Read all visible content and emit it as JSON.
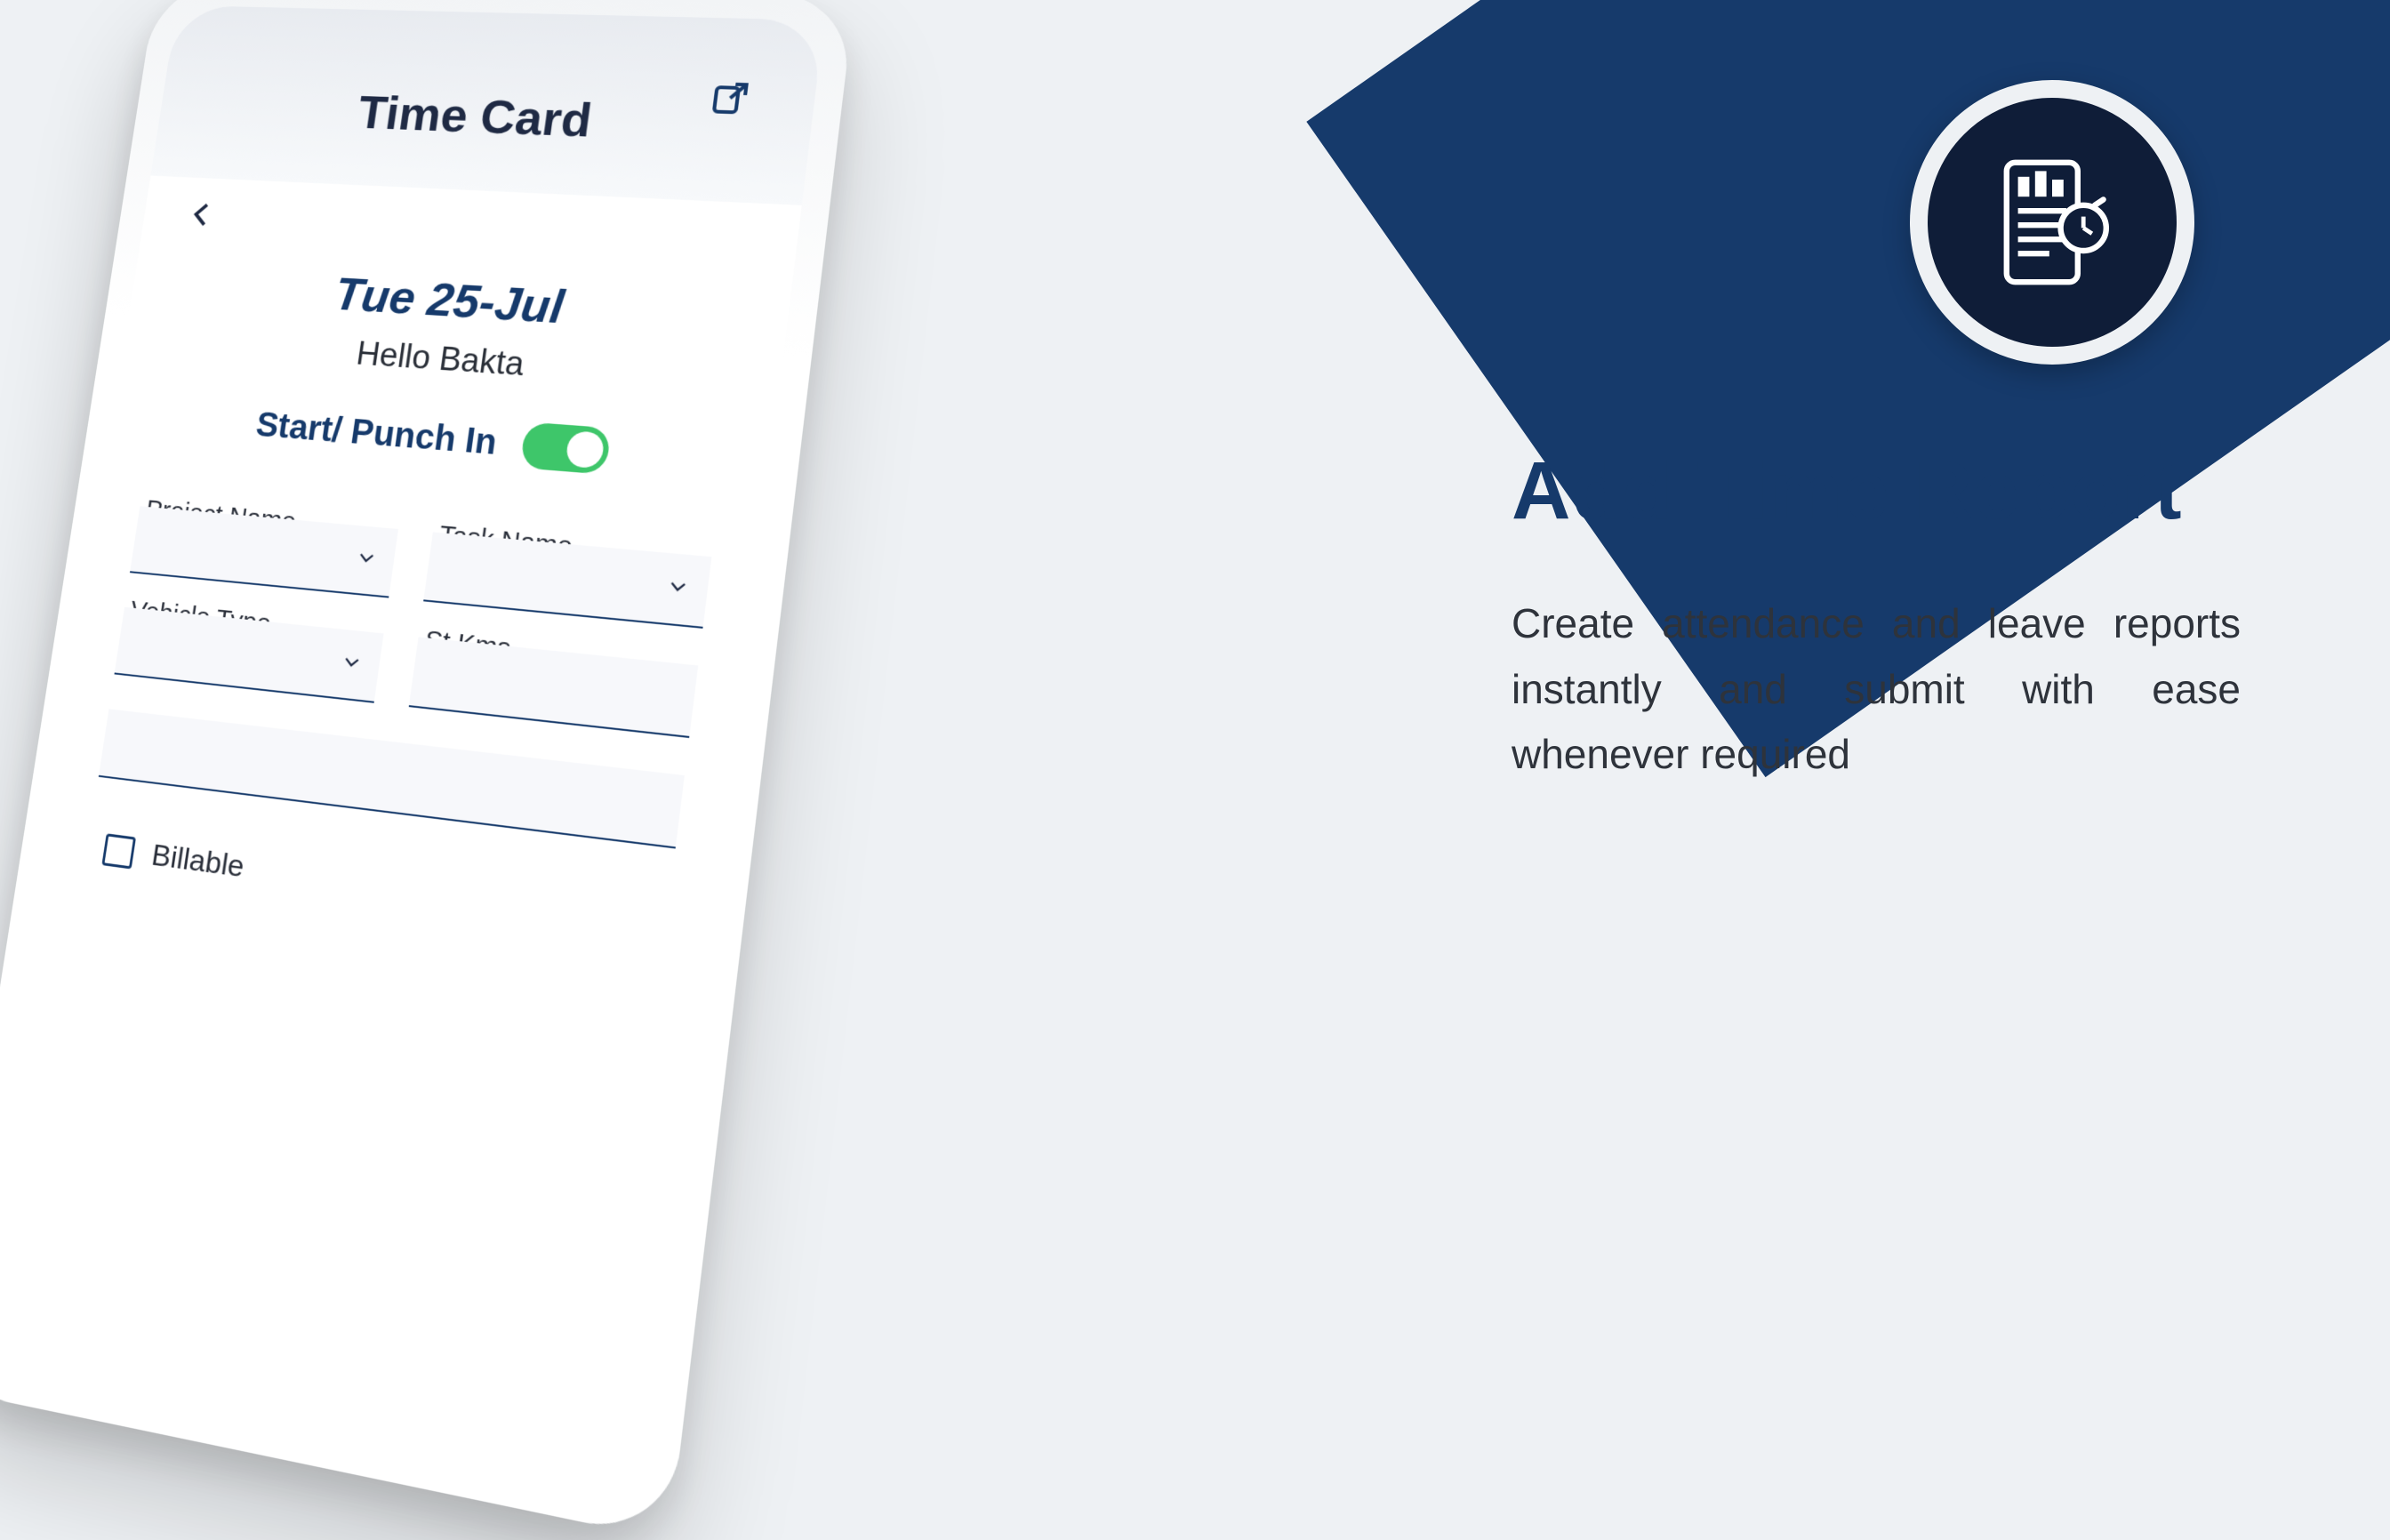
{
  "app": {
    "screen_title": "Time Card",
    "date_line": "Tue 25-Jul",
    "greeting": "Hello Bakta",
    "punch_label": "Start/ Punch In",
    "punch_state": true,
    "fields": {
      "project": {
        "label": "Project Name"
      },
      "task": {
        "label": "Task Name"
      },
      "vehicle": {
        "label": "Vehicle Type"
      },
      "stkms": {
        "label": "St Kms"
      }
    },
    "billable_label": "Billable",
    "icons": {
      "back": "back-arrow-icon",
      "export": "share-export-icon",
      "chevron": "chevron-down-icon",
      "checkbox": "checkbox-unchecked-icon"
    }
  },
  "feature": {
    "title": "Add Time Report",
    "description": "Create attendance and leave reports instantly and submit with ease whenever required",
    "badge_icon": "report-clock-icon"
  },
  "colors": {
    "brand_navy": "#163a6b",
    "badge_dark": "#0f1d38",
    "toggle_green": "#3ec66a",
    "page_bg": "#eef1f4"
  }
}
